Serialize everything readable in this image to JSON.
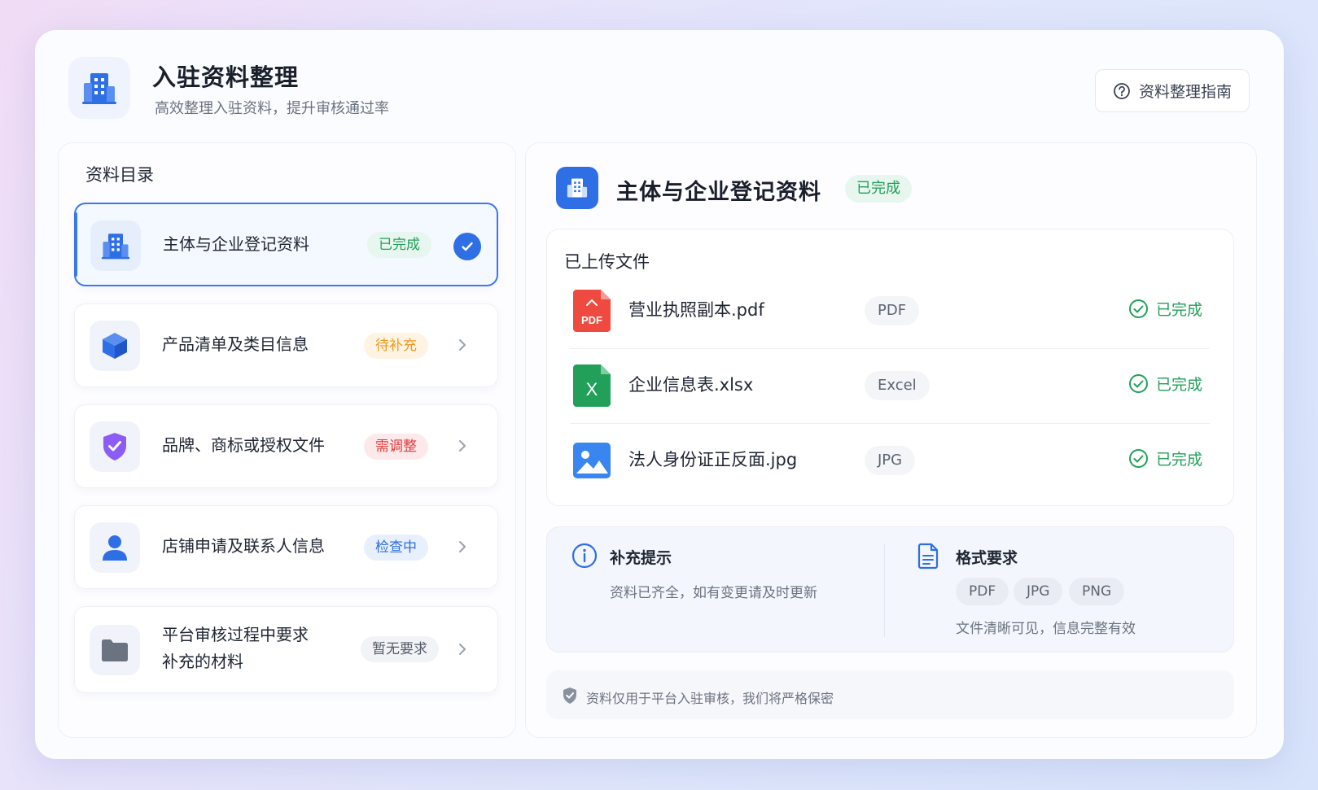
{
  "header": {
    "title": "入驻资料整理",
    "subtitle": "高效整理入驻资料，提升审核通过率",
    "guide_button": "资料整理指南",
    "logo_icon": "building-icon",
    "guide_icon": "help-circle-icon"
  },
  "sidebar": {
    "title": "资料目录",
    "items": [
      {
        "label": "主体与企业登记资料",
        "status": "已完成",
        "icon": "building-icon",
        "selected": true
      },
      {
        "label": "产品清单及类目信息",
        "status": "待补充",
        "icon": "cube-icon",
        "selected": false
      },
      {
        "label": "品牌、商标或授权文件",
        "status": "需调整",
        "icon": "shield-check-icon",
        "selected": false
      },
      {
        "label": "店铺申请及联系人信息",
        "status": "检查中",
        "icon": "user-icon",
        "selected": false
      },
      {
        "label_line1": "平台审核过程中要求",
        "label_line2": "补充的材料",
        "status": "暂无要求",
        "icon": "folder-icon",
        "selected": false
      }
    ]
  },
  "detail": {
    "title": "主体与企业登记资料",
    "status": "已完成",
    "files_title": "已上传文件",
    "files": [
      {
        "name": "营业执照副本.pdf",
        "type": "PDF",
        "status": "已完成",
        "icon": "pdf-file-icon"
      },
      {
        "name": "企业信息表.xlsx",
        "type": "Excel",
        "status": "已完成",
        "icon": "excel-file-icon"
      },
      {
        "name": "法人身份证正反面.jpg",
        "type": "JPG",
        "status": "已完成",
        "icon": "image-file-icon"
      }
    ],
    "hint": {
      "title": "补充提示",
      "text": "资料已齐全，如有变更请及时更新",
      "icon": "info-icon"
    },
    "format": {
      "title": "格式要求",
      "chips": [
        "PDF",
        "JPG",
        "PNG"
      ],
      "text": "文件清晰可见，信息完整有效",
      "icon": "document-icon"
    },
    "privacy": "资料仅用于平台入驻审核，我们将严格保密"
  },
  "colors": {
    "accent": "#2f6fe6",
    "success": "#22a05a",
    "warning": "#ef9a1b",
    "danger": "#e23b3b"
  }
}
